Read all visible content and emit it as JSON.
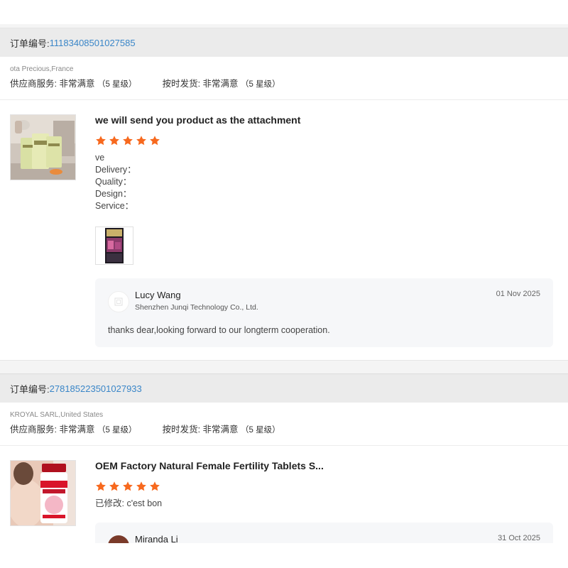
{
  "orders": [
    {
      "order_label": "订单编号:",
      "order_number": "11183408501027585",
      "buyer": "ota Precious,France",
      "supplier_service": {
        "label": "供应商服务:",
        "value": "非常满意",
        "score": "（5 星级）"
      },
      "on_time_shipping": {
        "label": "按时发货:",
        "value": "非常满意",
        "score": "（5 星级）"
      },
      "product_title": "we will send you product as the attachment",
      "stars": 5,
      "review_lines": [
        "ve",
        "Delivery：",
        "Quality：",
        "Design：",
        "Service："
      ],
      "reply": {
        "name": "Lucy Wang",
        "company": "Shenzhen Junqi Technology Co., Ltd.",
        "date": "01 Nov 2025",
        "text": "thanks dear,looking forward to our longterm cooperation."
      }
    },
    {
      "order_label": "订单编号:",
      "order_number": "278185223501027933",
      "buyer": "KROYAL SARL,United States",
      "supplier_service": {
        "label": "供应商服务:",
        "value": "非常满意",
        "score": "（5 星级）"
      },
      "on_time_shipping": {
        "label": "按时发货:",
        "value": "非常满意",
        "score": "（5 星级）"
      },
      "product_title": "OEM Factory Natural Female Fertility Tablets S...",
      "stars": 5,
      "review_text_label": "已修改:",
      "review_text": "c'est bon",
      "reply": {
        "name": "Miranda Li",
        "date": "31 Oct 2025"
      }
    }
  ],
  "colors": {
    "star": "#f7691e",
    "link": "#3a86c8",
    "header_bg": "#ebebeb",
    "reply_bg": "#f6f7f9"
  },
  "icons": {
    "star": "star-icon",
    "avatar_placeholder": "store-icon"
  }
}
